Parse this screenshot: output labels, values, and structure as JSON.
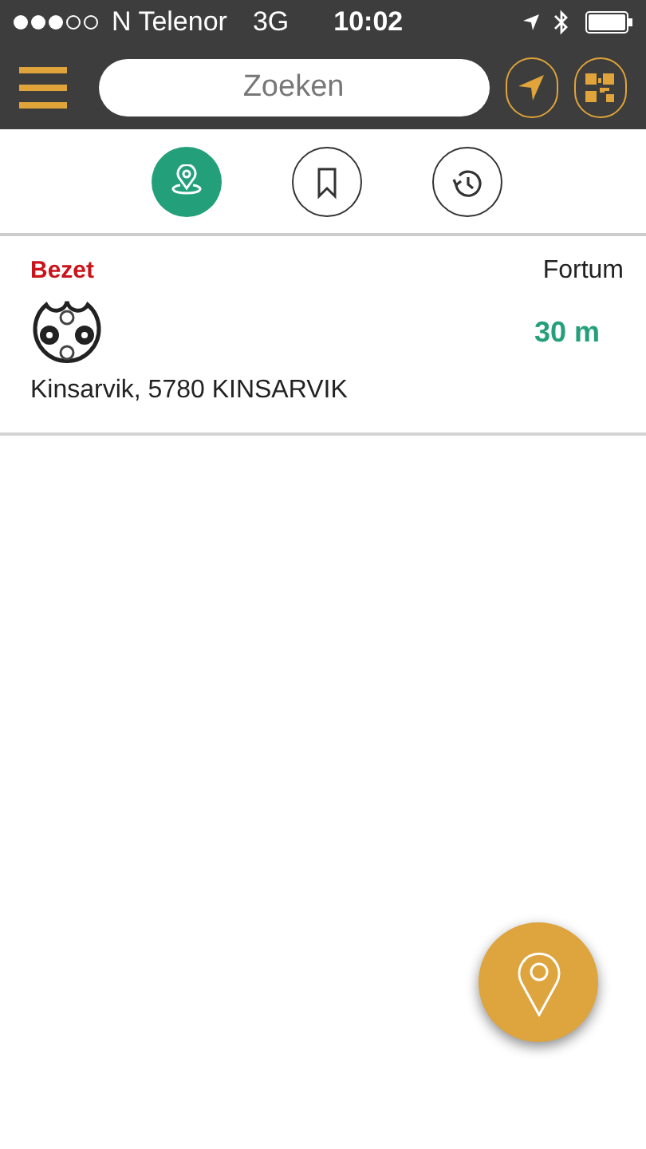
{
  "status_bar": {
    "carrier": "N Telenor",
    "network": "3G",
    "time": "10:02"
  },
  "search": {
    "placeholder": "Zoeken"
  },
  "tabs": [
    {
      "kind": "nearby",
      "selected": true
    },
    {
      "kind": "favorites",
      "selected": false
    },
    {
      "kind": "history",
      "selected": false
    }
  ],
  "stations": [
    {
      "status": "Bezet",
      "operator": "Fortum",
      "distance": "30 m",
      "address": "Kinsarvik, 5780 KINSARVIK"
    }
  ]
}
